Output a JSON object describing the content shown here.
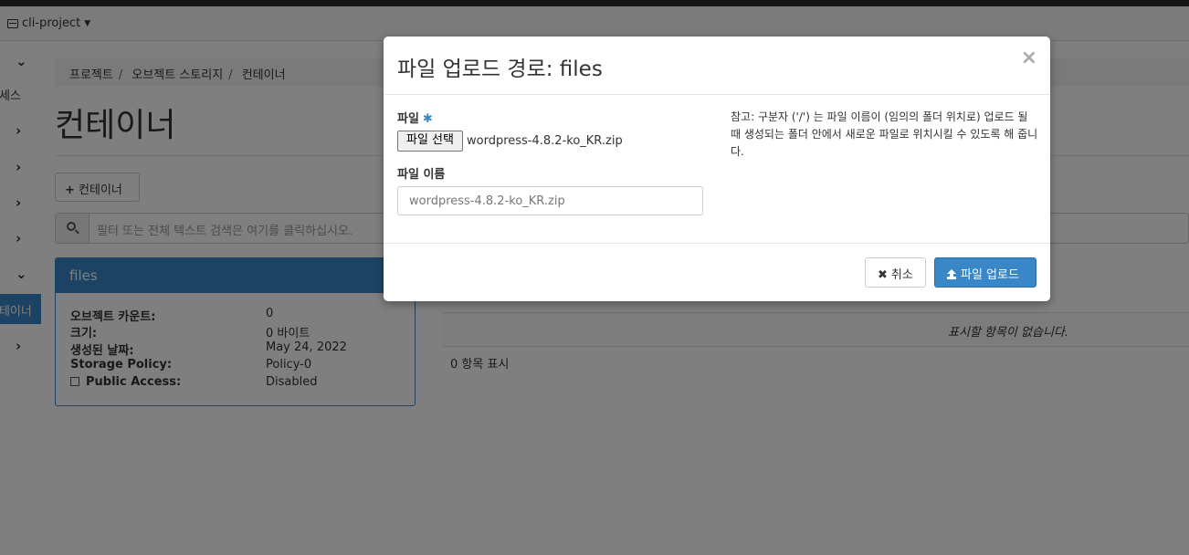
{
  "topbar": {
    "project": "cli-project"
  },
  "sidebar": {
    "access_text": "액세스",
    "active_text": "컨테이너"
  },
  "breadcrumb": [
    "프로젝트",
    "오브젝트 스토리지",
    "컨테이너"
  ],
  "page": {
    "title": "컨테이너",
    "add_container_label": "컨테이너",
    "filter_placeholder": "필터 또는 전체 텍스트 검색은 여기를 클릭하십시오."
  },
  "container_panel": {
    "name": "files",
    "details": [
      {
        "key": "오브젝트 카운트:",
        "value": "0"
      },
      {
        "key": "크기:",
        "value": "0 바이트"
      },
      {
        "key": "생성된 날짜:",
        "value": "May 24, 2022"
      },
      {
        "key": "Storage Policy:",
        "value": "Policy-0"
      },
      {
        "key": "Public Access:",
        "value": "Disabled"
      }
    ]
  },
  "objects_table": {
    "empty_message": "표시할 항목이 없습니다.",
    "count_text": "0 항목 표시"
  },
  "modal": {
    "title": "파일 업로드 경로: files",
    "close_glyph": "×",
    "file_label": "파일",
    "required_marker": "✱",
    "choose_file_label": "파일 선택",
    "chosen_file": "wordpress-4.8.2-ko_KR.zip",
    "file_name_label": "파일 이름",
    "file_name_value": "wordpress-4.8.2-ko_KR.zip",
    "help_text": "참고: 구분자 ('/') 는 파일 이름이 (임의의 폴더 위치로) 업로드 될 때 생성되는 폴더 안에서 새로운 파일로 위치시킬 수 있도록 해 줍니다.",
    "cancel_label": "취소",
    "upload_label": "파일 업로드"
  },
  "colors": {
    "primary": "#3a87c8",
    "backdrop": "rgba(0,0,0,0.5)"
  }
}
